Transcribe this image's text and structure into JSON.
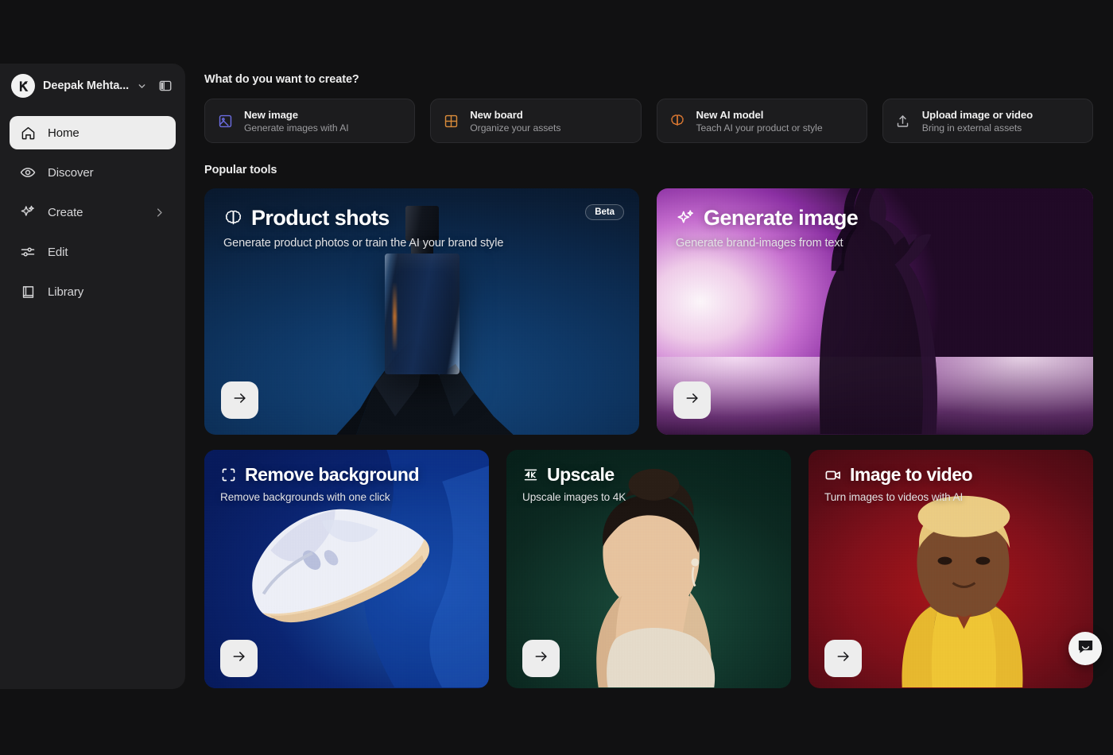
{
  "sidebar": {
    "account": {
      "name": "Deepak Mehta...",
      "avatar_icon": "brand-logo-icon",
      "chevron_icon": "chevron-down-icon",
      "panel_toggle_icon": "panel-toggle-icon"
    },
    "items": [
      {
        "label": "Home",
        "icon": "home-icon",
        "active": true
      },
      {
        "label": "Discover",
        "icon": "eye-icon",
        "active": false
      },
      {
        "label": "Create",
        "icon": "sparkle-icon",
        "active": false,
        "chevron": "chevron-right-icon"
      },
      {
        "label": "Edit",
        "icon": "sliders-icon",
        "active": false
      },
      {
        "label": "Library",
        "icon": "book-icon",
        "active": false
      }
    ]
  },
  "main": {
    "create_heading": "What do you want to create?",
    "quick_actions": [
      {
        "title": "New image",
        "subtitle": "Generate images with AI",
        "icon": "image-icon",
        "accent": "#6b6ce0"
      },
      {
        "title": "New board",
        "subtitle": "Organize your assets",
        "icon": "grid-icon",
        "accent": "#d98b3a"
      },
      {
        "title": "New AI model",
        "subtitle": "Teach AI your product or style",
        "icon": "brain-icon",
        "accent": "#e07a32"
      },
      {
        "title": "Upload image or video",
        "subtitle": "Bring in external assets",
        "icon": "upload-icon",
        "accent": "#b9b9bd"
      }
    ],
    "tools_heading": "Popular tools",
    "tools": [
      {
        "title": "Product shots",
        "subtitle": "Generate product photos or train the AI your brand style",
        "icon": "brain-icon",
        "badge": "Beta",
        "arrow_icon": "arrow-right-icon"
      },
      {
        "title": "Generate image",
        "subtitle": "Generate brand-images from text",
        "icon": "sparkle-icon",
        "badge": null,
        "arrow_icon": "arrow-right-icon"
      },
      {
        "title": "Remove background",
        "subtitle": "Remove backgrounds with one click",
        "icon": "crop-dashed-icon",
        "badge": null,
        "arrow_icon": "arrow-right-icon"
      },
      {
        "title": "Upscale",
        "subtitle": "Upscale images to 4K",
        "icon": "4k-icon",
        "badge": null,
        "arrow_icon": "arrow-right-icon"
      },
      {
        "title": "Image to video",
        "subtitle": "Turn images to videos with AI",
        "icon": "video-camera-icon",
        "badge": null,
        "arrow_icon": "arrow-right-icon"
      }
    ]
  },
  "chat": {
    "icon": "chat-bubble-icon"
  },
  "colors": {
    "app_background": "#111112",
    "sidebar_background": "#1d1d1f",
    "active_item_background": "#ededed",
    "card_background": "#1c1c1e",
    "card_border": "#2b2b2e"
  }
}
